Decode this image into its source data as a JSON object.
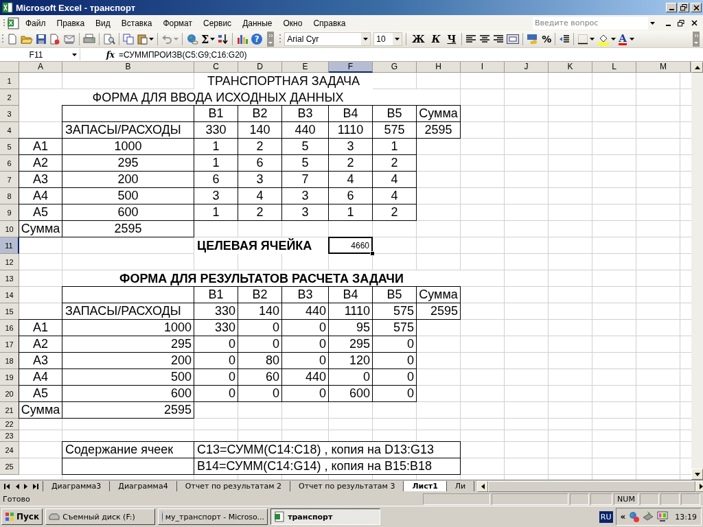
{
  "window": {
    "title": "Microsoft Excel - транспорт"
  },
  "menu": [
    "Файл",
    "Правка",
    "Вид",
    "Вставка",
    "Формат",
    "Сервис",
    "Данные",
    "Окно",
    "Справка"
  ],
  "help_search": {
    "placeholder": "Введите вопрос"
  },
  "standard_toolbar": {
    "sum": "Σ",
    "help": "?"
  },
  "formatting_toolbar": {
    "font": "Arial Cyr",
    "size": "10",
    "bold": "Ж",
    "italic": "К",
    "underline": "Ч",
    "percent": "%",
    "font_color": "A"
  },
  "formula_bar": {
    "name_box": "F11",
    "fx": "fx",
    "formula": "=СУММПРОИЗВ(C5:G9;C16:G20)"
  },
  "columns": [
    {
      "label": "A",
      "selected": false
    },
    {
      "label": "B",
      "selected": false
    },
    {
      "label": "C",
      "selected": false
    },
    {
      "label": "D",
      "selected": false
    },
    {
      "label": "E",
      "selected": false
    },
    {
      "label": "F",
      "selected": true
    },
    {
      "label": "G",
      "selected": false
    },
    {
      "label": "H",
      "selected": false
    },
    {
      "label": "I",
      "selected": false
    },
    {
      "label": "J",
      "selected": false
    },
    {
      "label": "K",
      "selected": false
    },
    {
      "label": "L",
      "selected": false
    },
    {
      "label": "M",
      "selected": false
    }
  ],
  "rows": [
    {
      "number": "1",
      "selected": false,
      "kind": "normal",
      "cells": {
        "c": {
          "text": "ТРАНСПОРТНАЯ ЗАДАЧА",
          "kind": "title"
        }
      }
    },
    {
      "number": "2",
      "selected": false,
      "kind": "normal",
      "cells": {
        "a": {
          "text": "ФОРМА ДЛЯ ВВОДА ИСХОДНЫХ ДАННЫХ",
          "kind": "heading"
        }
      }
    },
    {
      "number": "3",
      "selected": false,
      "kind": "normal",
      "cells": {
        "b": {
          "kind": "box"
        },
        "c": {
          "text": "B1",
          "kind": "box-center"
        },
        "d": {
          "text": "B2",
          "kind": "box-center"
        },
        "e": {
          "text": "B3",
          "kind": "box-center"
        },
        "f": {
          "text": "B4",
          "kind": "box-center"
        },
        "g": {
          "text": "B5",
          "kind": "box-center"
        },
        "h": {
          "text": "Сумма",
          "kind": "box-center"
        }
      }
    },
    {
      "number": "4",
      "selected": false,
      "kind": "normal",
      "cells": {
        "b": {
          "text": "ЗАПАСЫ/РАСХОДЫ",
          "kind": "box-left"
        },
        "c": {
          "text": "330",
          "kind": "box-center"
        },
        "d": {
          "text": "140",
          "kind": "box-center"
        },
        "e": {
          "text": "440",
          "kind": "box-center"
        },
        "f": {
          "text": "1110",
          "kind": "box-center"
        },
        "g": {
          "text": "575",
          "kind": "box-center"
        },
        "h": {
          "text": "2595",
          "kind": "box-center"
        }
      }
    },
    {
      "number": "5",
      "selected": false,
      "kind": "normal",
      "cells": {
        "a": {
          "text": "A1",
          "kind": "box-center"
        },
        "b": {
          "text": "1000",
          "kind": "box-center"
        },
        "c": {
          "text": "1",
          "kind": "box-center"
        },
        "d": {
          "text": "2",
          "kind": "box-center"
        },
        "e": {
          "text": "5",
          "kind": "box-center"
        },
        "f": {
          "text": "3",
          "kind": "box-center"
        },
        "g": {
          "text": "1",
          "kind": "box-center"
        }
      }
    },
    {
      "number": "6",
      "selected": false,
      "kind": "normal",
      "cells": {
        "a": {
          "text": "A2",
          "kind": "box-center"
        },
        "b": {
          "text": "295",
          "kind": "box-center"
        },
        "c": {
          "text": "1",
          "kind": "box-center"
        },
        "d": {
          "text": "6",
          "kind": "box-center"
        },
        "e": {
          "text": "5",
          "kind": "box-center"
        },
        "f": {
          "text": "2",
          "kind": "box-center"
        },
        "g": {
          "text": "2",
          "kind": "box-center"
        }
      }
    },
    {
      "number": "7",
      "selected": false,
      "kind": "normal",
      "cells": {
        "a": {
          "text": "A3",
          "kind": "box-center"
        },
        "b": {
          "text": "200",
          "kind": "box-center"
        },
        "c": {
          "text": "6",
          "kind": "box-center"
        },
        "d": {
          "text": "3",
          "kind": "box-center"
        },
        "e": {
          "text": "7",
          "kind": "box-center"
        },
        "f": {
          "text": "4",
          "kind": "box-center"
        },
        "g": {
          "text": "4",
          "kind": "box-center"
        }
      }
    },
    {
      "number": "8",
      "selected": false,
      "kind": "normal",
      "cells": {
        "a": {
          "text": "A4",
          "kind": "box-center"
        },
        "b": {
          "text": "500",
          "kind": "box-center"
        },
        "c": {
          "text": "3",
          "kind": "box-center"
        },
        "d": {
          "text": "4",
          "kind": "box-center"
        },
        "e": {
          "text": "3",
          "kind": "box-center"
        },
        "f": {
          "text": "6",
          "kind": "box-center"
        },
        "g": {
          "text": "4",
          "kind": "box-center"
        }
      }
    },
    {
      "number": "9",
      "selected": false,
      "kind": "normal",
      "cells": {
        "a": {
          "text": "A5",
          "kind": "box-center"
        },
        "b": {
          "text": "600",
          "kind": "box-center"
        },
        "c": {
          "text": "1",
          "kind": "box-center"
        },
        "d": {
          "text": "2",
          "kind": "box-center"
        },
        "e": {
          "text": "3",
          "kind": "box-center"
        },
        "f": {
          "text": "1",
          "kind": "box-center"
        },
        "g": {
          "text": "2",
          "kind": "box-center"
        }
      }
    },
    {
      "number": "10",
      "selected": false,
      "kind": "normal",
      "cells": {
        "a": {
          "text": "Сумма",
          "kind": "box-center"
        },
        "b": {
          "text": "2595",
          "kind": "box-center"
        }
      }
    },
    {
      "number": "11",
      "selected": true,
      "kind": "normal",
      "cells": {
        "c": {
          "text": "ЦЕЛЕВАЯ ЯЧЕЙКА",
          "kind": "label"
        },
        "f": {
          "text": "4660",
          "kind": "small-right"
        }
      }
    },
    {
      "number": "12",
      "selected": false,
      "kind": "normal",
      "cells": {}
    },
    {
      "number": "13",
      "selected": false,
      "kind": "normal",
      "cells": {
        "b": {
          "text": "ФОРМА ДЛЯ РЕЗУЛЬТАТОВ РАСЧЕТА ЗАДАЧИ",
          "kind": "heading-bold"
        }
      }
    },
    {
      "number": "14",
      "selected": false,
      "kind": "normal",
      "cells": {
        "b": {
          "kind": "box"
        },
        "c": {
          "text": "B1",
          "kind": "box-center"
        },
        "d": {
          "text": "B2",
          "kind": "box-center"
        },
        "e": {
          "text": "B3",
          "kind": "box-center"
        },
        "f": {
          "text": "B4",
          "kind": "box-center"
        },
        "g": {
          "text": "B5",
          "kind": "box-center"
        },
        "h": {
          "text": "Сумма",
          "kind": "box-center"
        }
      }
    },
    {
      "number": "15",
      "selected": false,
      "kind": "normal",
      "cells": {
        "b": {
          "text": "ЗАПАСЫ/РАСХОДЫ",
          "kind": "box-left"
        },
        "c": {
          "text": "330",
          "kind": "box-right"
        },
        "d": {
          "text": "140",
          "kind": "box-right"
        },
        "e": {
          "text": "440",
          "kind": "box-right"
        },
        "f": {
          "text": "1110",
          "kind": "box-right"
        },
        "g": {
          "text": "575",
          "kind": "box-right"
        },
        "h": {
          "text": "2595",
          "kind": "box-right"
        }
      }
    },
    {
      "number": "16",
      "selected": false,
      "kind": "normal",
      "cells": {
        "a": {
          "text": "A1",
          "kind": "box-center"
        },
        "b": {
          "text": "1000",
          "kind": "box-right"
        },
        "c": {
          "text": "330",
          "kind": "box-right"
        },
        "d": {
          "text": "0",
          "kind": "box-right"
        },
        "e": {
          "text": "0",
          "kind": "box-right"
        },
        "f": {
          "text": "95",
          "kind": "box-right"
        },
        "g": {
          "text": "575",
          "kind": "box-right"
        }
      }
    },
    {
      "number": "17",
      "selected": false,
      "kind": "normal",
      "cells": {
        "a": {
          "text": "A2",
          "kind": "box-center"
        },
        "b": {
          "text": "295",
          "kind": "box-right"
        },
        "c": {
          "text": "0",
          "kind": "box-right"
        },
        "d": {
          "text": "0",
          "kind": "box-right"
        },
        "e": {
          "text": "0",
          "kind": "box-right"
        },
        "f": {
          "text": "295",
          "kind": "box-right"
        },
        "g": {
          "text": "0",
          "kind": "box-right"
        }
      }
    },
    {
      "number": "18",
      "selected": false,
      "kind": "normal",
      "cells": {
        "a": {
          "text": "A3",
          "kind": "box-center"
        },
        "b": {
          "text": "200",
          "kind": "box-right"
        },
        "c": {
          "text": "0",
          "kind": "box-right"
        },
        "d": {
          "text": "80",
          "kind": "box-right"
        },
        "e": {
          "text": "0",
          "kind": "box-right"
        },
        "f": {
          "text": "120",
          "kind": "box-right"
        },
        "g": {
          "text": "0",
          "kind": "box-right"
        }
      }
    },
    {
      "number": "19",
      "selected": false,
      "kind": "normal",
      "cells": {
        "a": {
          "text": "A4",
          "kind": "box-center"
        },
        "b": {
          "text": "500",
          "kind": "box-right"
        },
        "c": {
          "text": "0",
          "kind": "box-right"
        },
        "d": {
          "text": "60",
          "kind": "box-right"
        },
        "e": {
          "text": "440",
          "kind": "box-right"
        },
        "f": {
          "text": "0",
          "kind": "box-right"
        },
        "g": {
          "text": "0",
          "kind": "box-right"
        }
      }
    },
    {
      "number": "20",
      "selected": false,
      "kind": "normal",
      "cells": {
        "a": {
          "text": "A5",
          "kind": "box-center"
        },
        "b": {
          "text": "600",
          "kind": "box-right"
        },
        "c": {
          "text": "0",
          "kind": "box-right"
        },
        "d": {
          "text": "0",
          "kind": "box-right"
        },
        "e": {
          "text": "0",
          "kind": "box-right"
        },
        "f": {
          "text": "600",
          "kind": "box-right"
        },
        "g": {
          "text": "0",
          "kind": "box-right"
        }
      }
    },
    {
      "number": "21",
      "selected": false,
      "kind": "normal",
      "cells": {
        "a": {
          "text": "Сумма",
          "kind": "box-center"
        },
        "b": {
          "text": "2595",
          "kind": "box-right"
        }
      }
    },
    {
      "number": "22",
      "selected": false,
      "kind": "short",
      "cells": {}
    },
    {
      "number": "23",
      "selected": false,
      "kind": "short",
      "cells": {}
    },
    {
      "number": "24",
      "selected": false,
      "kind": "normal",
      "cells": {
        "b": {
          "text": "Содержание ячеек",
          "kind": "box-left"
        },
        "c": {
          "text": "C13=СУММ(C14:C18) , копия на D13:G13",
          "kind": "note"
        }
      }
    },
    {
      "number": "25",
      "selected": false,
      "kind": "normal",
      "cells": {
        "b": {
          "kind": "box"
        },
        "c": {
          "text": "B14=СУММ(C14:G14) , копия на B15:B18",
          "kind": "note"
        }
      }
    }
  ],
  "sheet_tabs": [
    {
      "label": "Диаграмма3",
      "selected": false
    },
    {
      "label": "Диаграмма4",
      "selected": false
    },
    {
      "label": "Отчет по результатам 2",
      "selected": false
    },
    {
      "label": "Отчет по результатам 3",
      "selected": false
    },
    {
      "label": "Лист1",
      "selected": true
    },
    {
      "label": "Ли",
      "selected": false
    }
  ],
  "status_bar": {
    "text": "Готово",
    "num": "NUM"
  },
  "taskbar": {
    "start": "Пуск",
    "buttons": [
      {
        "label": "Съемный диск (F:)",
        "selected": false,
        "kind": "drive"
      },
      {
        "label": "му_транспорт - Microso...",
        "selected": false,
        "kind": "word"
      },
      {
        "label": "транспорт",
        "selected": true,
        "kind": "excel"
      }
    ],
    "language": "RU",
    "tray_toggle": "«",
    "clock": "13:19"
  }
}
